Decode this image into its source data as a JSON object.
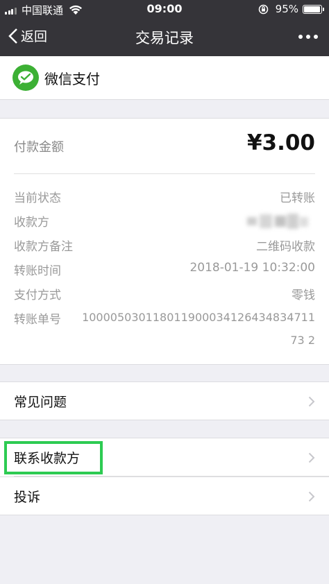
{
  "status_bar": {
    "carrier": "中国联通",
    "time": "09:00",
    "battery": "95%",
    "battery_level": 0.95,
    "icons": [
      "signal-icon",
      "wifi-icon",
      "rotation-lock-icon",
      "battery-icon"
    ]
  },
  "nav": {
    "back_label": "返回",
    "title": "交易记录",
    "more_icon": "more-icon"
  },
  "brand": {
    "name": "微信支付",
    "icon": "wechat-pay-icon",
    "color": "#3cb034"
  },
  "amount": {
    "label": "付款金额",
    "value": "¥3.00"
  },
  "details": [
    {
      "label": "当前状态",
      "value": "已转账"
    },
    {
      "label": "收款方",
      "value": ""
    },
    {
      "label": "收款方备注",
      "value": "二维码收款"
    },
    {
      "label": "转账时间",
      "value": "2018-01-19 10:32:00"
    },
    {
      "label": "支付方式",
      "value": "零钱"
    },
    {
      "label": "转账单号",
      "value": "10000503011801190003412643483471173 2"
    }
  ],
  "actions": {
    "faq": "常见问题",
    "contact": "联系收款方",
    "complain": "投诉"
  },
  "colors": {
    "nav_bg": "#353439",
    "page_bg": "#efeff4",
    "highlight": "#2dcb52"
  }
}
